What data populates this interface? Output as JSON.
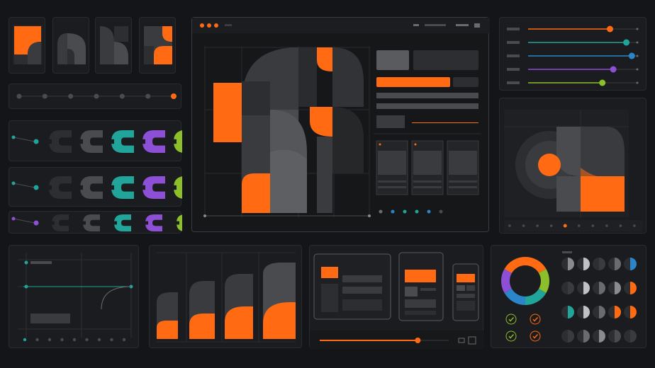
{
  "accent": "#ff6a13",
  "palette": {
    "orange": "#ff6a13",
    "teal": "#21a59a",
    "blue": "#2a86c9",
    "purple": "#8d4fd6",
    "lime": "#8cbf2a",
    "grey_dark": "#2d2e31",
    "grey_mid": "#4a4b4f",
    "grey_light": "#6a6b6f"
  },
  "top_tiles": [
    "tile-orange-corner",
    "tile-grey-arches",
    "tile-grey-quarters",
    "tile-orange-quarter"
  ],
  "timeline": {
    "dot_count": 7,
    "active_index": 6
  },
  "c_shape_rows": [
    {
      "colors": [
        "#2d2e31",
        "#4a4b4f",
        "#21a59a",
        "#8d4fd6",
        "#8cbf2a"
      ],
      "start_color": "#21a59a"
    },
    {
      "colors": [
        "#2d2e31",
        "#4a4b4f",
        "#21a59a",
        "#8d4fd6",
        "#8cbf2a"
      ],
      "start_color": "#21a59a"
    },
    {
      "colors": [
        "#2d2e31",
        "#4a4b4f",
        "#21a59a",
        "#8d4fd6",
        "#8cbf2a"
      ],
      "start_color": "#8d4fd6"
    }
  ],
  "main_window": {
    "icons": [
      "window-close-icon",
      "window-min-icon",
      "window-max-icon"
    ],
    "pager_dots": [
      "#6a6b6f",
      "#2a86c9",
      "#21a59a",
      "#21a59a",
      "#2a86c9",
      "#4a4b4f"
    ]
  },
  "sliders": [
    {
      "color": "#ff6a13",
      "value": 0.75
    },
    {
      "color": "#21a59a",
      "value": 0.9
    },
    {
      "color": "#2a86c9",
      "value": 0.95
    },
    {
      "color": "#8d4fd6",
      "value": 0.78
    },
    {
      "color": "#8cbf2a",
      "value": 0.68
    }
  ],
  "carousel": {
    "dot_count": 10,
    "active_index": 4
  },
  "progress_slider": {
    "value": 0.76
  },
  "devices": [
    "desktop",
    "tablet",
    "phone"
  ],
  "color_wheel": {
    "segments": [
      "#ff6a13",
      "#8cbf2a",
      "#21a59a",
      "#2a86c9",
      "#8d4fd6",
      "#ff6a13"
    ]
  },
  "checks": [
    "check-icon",
    "check-icon",
    "check-icon",
    "check-icon",
    "check-icon",
    "check-icon"
  ]
}
